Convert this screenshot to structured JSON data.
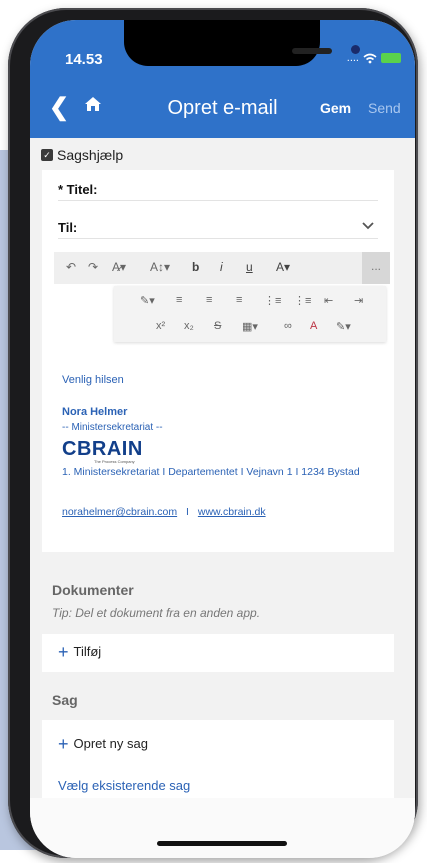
{
  "status_bar": {
    "time": "14.53",
    "signal": "....",
    "wifi_icon": "wifi-icon",
    "battery_icon": "battery-charging-icon"
  },
  "nav": {
    "back_icon": "chevron-left-icon",
    "home_icon": "home-icon",
    "title": "Opret e-mail",
    "gem": "Gem",
    "send": "Send"
  },
  "sagshjaelp": {
    "label": "Sagshjælp",
    "checked": true
  },
  "form": {
    "titel_label": "* Titel:",
    "til_label": "Til:"
  },
  "toolbar": {
    "row1": [
      "↶",
      "↷",
      "A̷▾",
      "A↕▾",
      "b",
      "i",
      "u",
      "A▾",
      "..."
    ],
    "row2": [
      "✎▾",
      "≡",
      "≡",
      "≡",
      "⋮≡",
      "⋮≡",
      "⇤",
      "⇥"
    ],
    "row3": [
      "x²",
      "x₂",
      "S",
      "▦▾",
      "∞",
      "A",
      "✎▾"
    ]
  },
  "signature": {
    "greeting": "Venlig hilsen",
    "name": "Nora Helmer",
    "department": "-- Ministersekretariat --",
    "logo_text": "CBRAIN",
    "logo_tagline": "The Process Company",
    "address": "1. Ministersekretariat  I  Departementet  I  Vejnavn 1  I  1234 Bystad",
    "email": "norahelmer@cbrain.com",
    "separator": "I",
    "website": "www.cbrain.dk"
  },
  "dokumenter": {
    "heading": "Dokumenter",
    "tip": "Tip: Del et dokument fra en anden app.",
    "add_label": "Tilføj"
  },
  "sag": {
    "heading": "Sag",
    "new_label": "Opret ny sag",
    "existing_label": "Vælg eksisterende sag"
  },
  "colors": {
    "appbar": "#2f72c9",
    "link": "#2b62b5"
  }
}
